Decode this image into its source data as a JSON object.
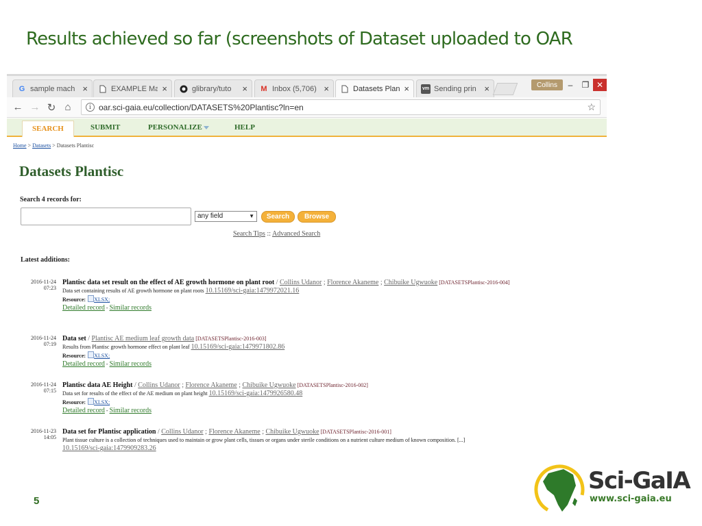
{
  "slide": {
    "title": "Results achieved so far (screenshots of Dataset uploaded to OAR",
    "page_number": "5"
  },
  "browser": {
    "tabs": [
      {
        "label": "sample mach",
        "icon": "google-icon"
      },
      {
        "label": "EXAMPLE Ma",
        "icon": "document-icon"
      },
      {
        "label": "glibrary/tuto",
        "icon": "github-icon"
      },
      {
        "label": "Inbox (5,706)",
        "icon": "gmail-icon"
      },
      {
        "label": "Datasets Plan",
        "icon": "document-icon",
        "active": true
      },
      {
        "label": "Sending prin",
        "icon": "vm-icon"
      }
    ],
    "user": "Collins",
    "url": "oar.sci-gaia.eu/collection/DATASETS%20Plantisc?ln=en"
  },
  "site_nav": {
    "search": "SEARCH",
    "submit": "SUBMIT",
    "personalize": "PERSONALIZE",
    "help": "HELP"
  },
  "breadcrumb": {
    "home": "Home",
    "datasets": "Datasets",
    "current": "Datasets Plantisc",
    "separator": ">"
  },
  "collection": {
    "title": "Datasets Plantisc",
    "search_label": "Search 4 records for:",
    "search_value": "",
    "field_select": "any field",
    "search_button": "Search",
    "browse_button": "Browse",
    "search_tips": "Search Tips",
    "tips_separator": "::",
    "advanced_search": "Advanced Search",
    "latest_label": "Latest additions:"
  },
  "records": [
    {
      "date": "2016-11-24",
      "time": "07:23",
      "title": "Plantisc data set result on the effect of AE growth hormone on plant root",
      "authors": [
        "Collins Udanor",
        "Florence Akaneme",
        "Chibuike Ugwuoke"
      ],
      "tag": "[DATASETSPlantisc-2016-004]",
      "description": "Data set containing results of AE growth hormone on plant roots",
      "doi": "10.15169/sci-gaia:1479972021.16",
      "resource_label": "Resource:",
      "resource": "XLSX;",
      "detailed": "Detailed record",
      "similar": "Similar records"
    },
    {
      "date": "2016-11-24",
      "time": "07:19",
      "title": "Data set",
      "authors": [
        "Plantisc AE medium leaf growth data"
      ],
      "tag": "[DATASETSPlantisc-2016-003]",
      "description": "Results from Plantisc growth hormone effect on plant leaf",
      "doi": "10.15169/sci-gaia:1479971802.86",
      "resource_label": "Resource:",
      "resource": "XLSX;",
      "detailed": "Detailed record",
      "similar": "Similar records"
    },
    {
      "date": "2016-11-24",
      "time": "07:15",
      "title": "Plantisc data AE Height",
      "authors": [
        "Collins Udanor",
        "Florence Akaneme",
        "Chibuike Ugwuoke"
      ],
      "tag": "[DATASETSPlantisc-2016-002]",
      "description": "Data set for results of the effect of the AE medium on plant height",
      "doi": "10.15169/sci-gaia:1479926580.48",
      "resource_label": "Resource:",
      "resource": "XLSX;",
      "detailed": "Detailed record",
      "similar": "Similar records"
    },
    {
      "date": "2016-11-23",
      "time": "14:05",
      "title": "Data set for Plantisc application",
      "authors": [
        "Collins Udanor",
        "Florence Akaneme",
        "Chibuike Ugwuoke"
      ],
      "tag": "[DATASETSPlantisc-2016-001]",
      "description": "Plant tissue culture is a collection of techniques used to maintain or grow plant cells, tissues or organs under sterile conditions on a nutrient culture medium of known composition. [...]",
      "doi": "10.15169/sci-gaia:1479909283.26"
    }
  ],
  "logo": {
    "name": "Sci-GaIA",
    "url": "www.sci-gaia.eu"
  },
  "colors": {
    "title_green": "#2e6b1f",
    "accent_orange": "#f4b13a",
    "nav_green": "#2f6b2a"
  }
}
